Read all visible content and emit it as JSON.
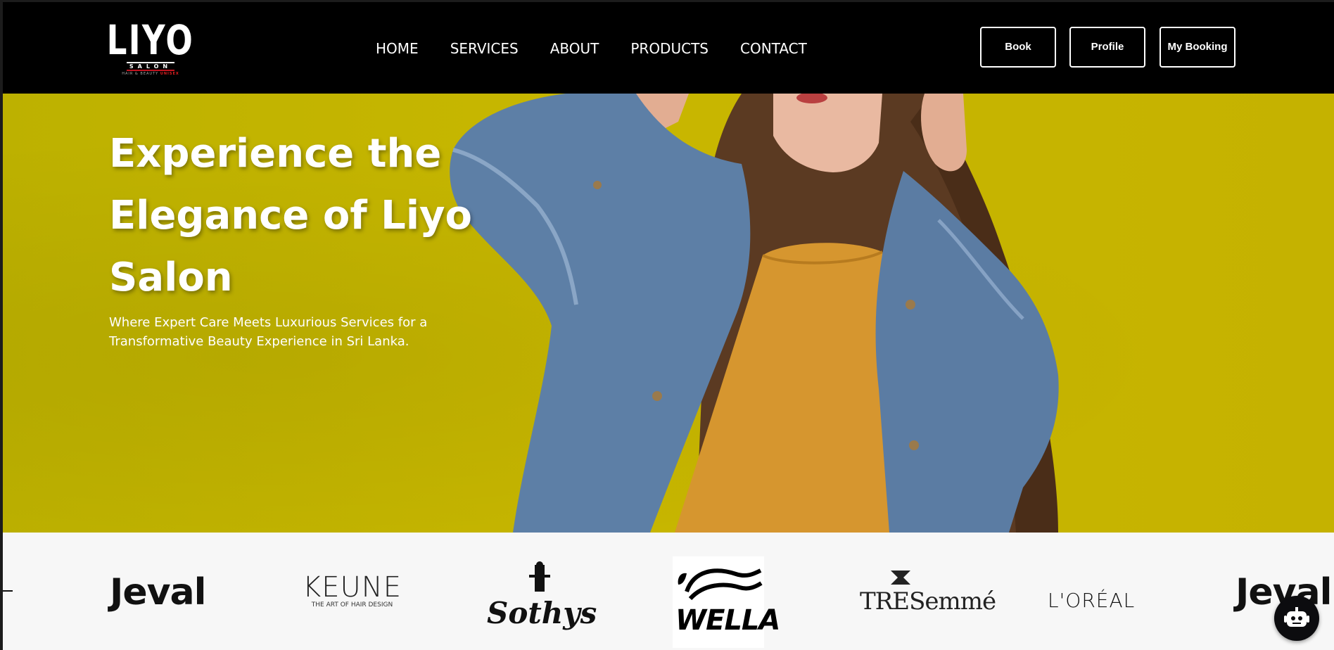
{
  "brand": {
    "logo_text": "LIYO",
    "logo_sub": "SALON",
    "logo_tag_prefix": "HAIR & BEAUTY",
    "logo_tag_accent": "UNISEX"
  },
  "nav": {
    "links": [
      "HOME",
      "SERVICES",
      "ABOUT",
      "PRODUCTS",
      "CONTACT"
    ],
    "buttons": {
      "book": "Book",
      "profile": "Profile",
      "my_booking": "My Booking"
    }
  },
  "hero": {
    "title": "Experience the Elegance of Liyo Salon",
    "subtitle": "Where Expert Care Meets Luxurious Services for a Transformative Beauty Experience in Sri Lanka."
  },
  "brands": {
    "items": [
      "Jeval",
      "KEUNE",
      "Sothys",
      "WELLA",
      "TRESemmé",
      "L'ORÉAL",
      "Jeval"
    ],
    "keune_tagline": "THE ART OF HAIR DESIGN"
  },
  "colors": {
    "nav_bg": "#000000",
    "hero_bg": "#c4b400",
    "brand_strip_bg": "#f7f7f7",
    "logo_accent": "#c1121f"
  },
  "icons": {
    "chatbot": "robot-icon"
  }
}
